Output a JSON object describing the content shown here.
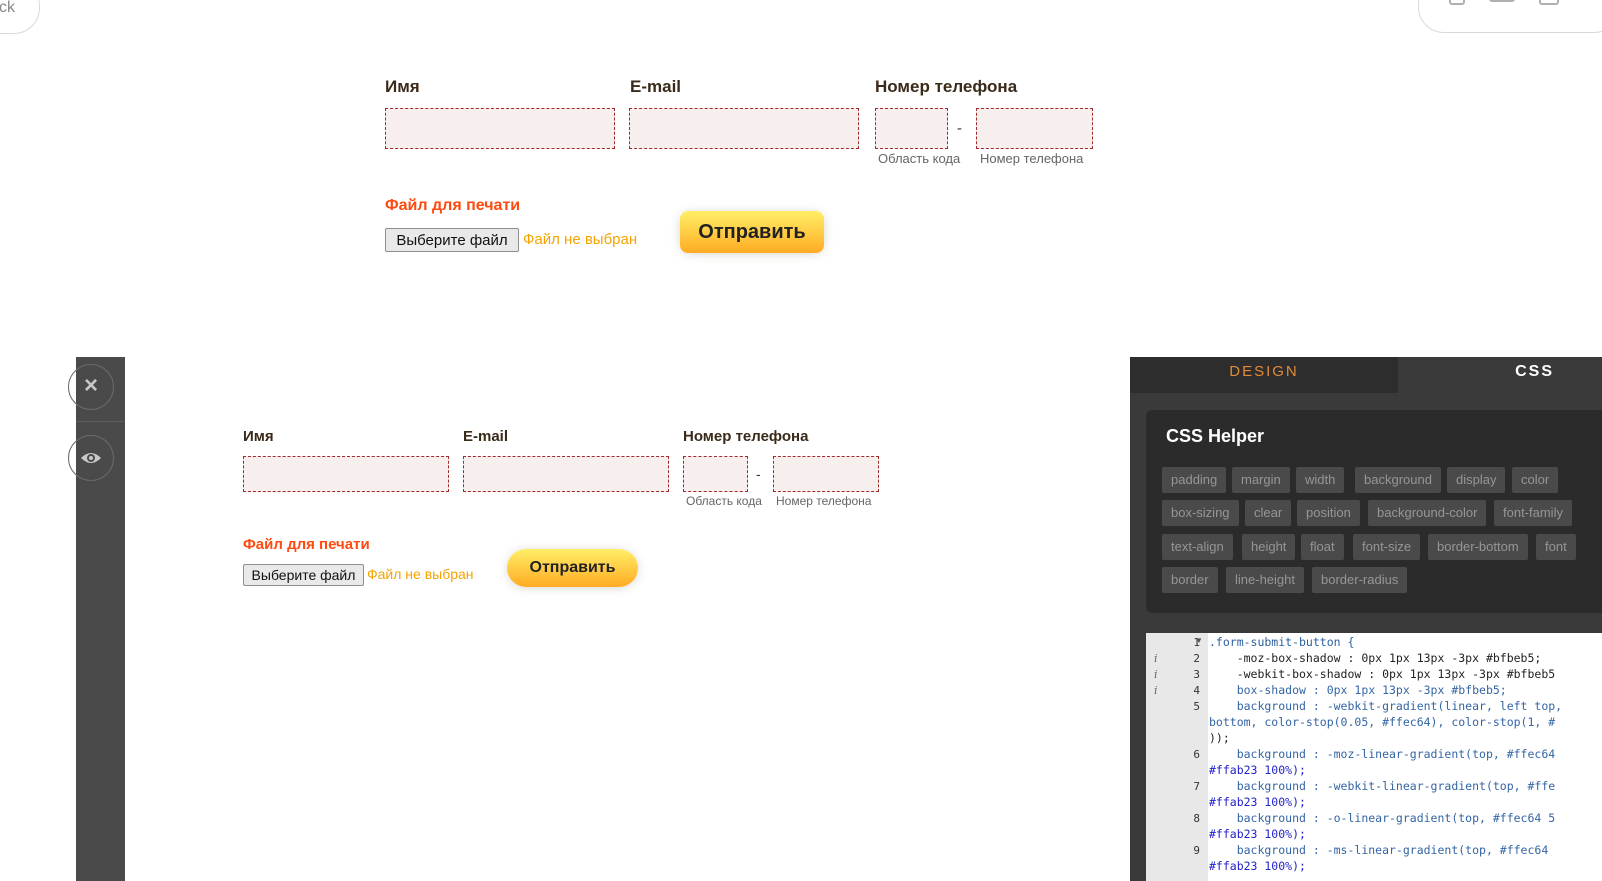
{
  "top_nav": {
    "back_fragment": "ck"
  },
  "form_top": {
    "name_label": "Имя",
    "email_label": "E-mail",
    "phone_label": "Номер телефона",
    "area_code_hint": "Область кода",
    "phone_number_hint": "Номер телефона",
    "separator": "-",
    "file_label": "Файл для печати",
    "choose_file": "Выберите файл",
    "no_file": "Файл не выбран",
    "submit": "Отправить"
  },
  "form_preview": {
    "name_label": "Имя",
    "email_label": "E-mail",
    "phone_label": "Номер телефона",
    "area_code_hint": "Область кода",
    "phone_number_hint": "Номер телефона",
    "separator": "-",
    "file_label": "Файл для печати",
    "choose_file": "Выберите файл",
    "no_file": "Файл не выбран",
    "submit": "Отправить"
  },
  "sidebar": {
    "close_icon": "×",
    "preview_icon": "eye-icon"
  },
  "panel": {
    "tabs": [
      "DESIGN",
      "CSS"
    ],
    "helper_title": "CSS Helper",
    "chips": [
      [
        "padding",
        "margin",
        "width",
        "background",
        "display",
        "color"
      ],
      [
        "box-sizing",
        "clear",
        "position",
        "background-color",
        "font-family"
      ],
      [
        "text-align",
        "height",
        "float",
        "font-size",
        "border-bottom",
        "font"
      ],
      [
        "border",
        "line-height",
        "border-radius"
      ]
    ],
    "line_numbers": [
      "1",
      "2",
      "3",
      "4",
      "5",
      "6",
      "7",
      "8",
      "9"
    ],
    "code": [
      ".form-submit-button {",
      "    -moz-box-shadow : 0px 1px 13px -3px #bfbeb5;",
      "    -webkit-box-shadow : 0px 1px 13px -3px #bfbeb5",
      "    box-shadow : 0px 1px 13px -3px #bfbeb5;",
      "    background : -webkit-gradient(linear, left top,",
      "bottom, color-stop(0.05, #ffec64), color-stop(1, #",
      "));",
      "    background : -moz-linear-gradient(top, #ffec64",
      "#ffab23 100%);",
      "    background : -webkit-linear-gradient(top, #ffe",
      "#ffab23 100%);",
      "    background : -o-linear-gradient(top, #ffec64 5",
      "#ffab23 100%);",
      "    background : -ms-linear-gradient(top, #ffec64",
      "#ffab23 100%);"
    ]
  },
  "colors": {
    "accent_orange": "#ff4a0f",
    "no_file_text": "#f5a300",
    "button_gradient_top": "#ffec64",
    "button_gradient_bottom": "#ffab23",
    "field_border": "#a42b2b",
    "field_bg": "#f7eeee"
  }
}
